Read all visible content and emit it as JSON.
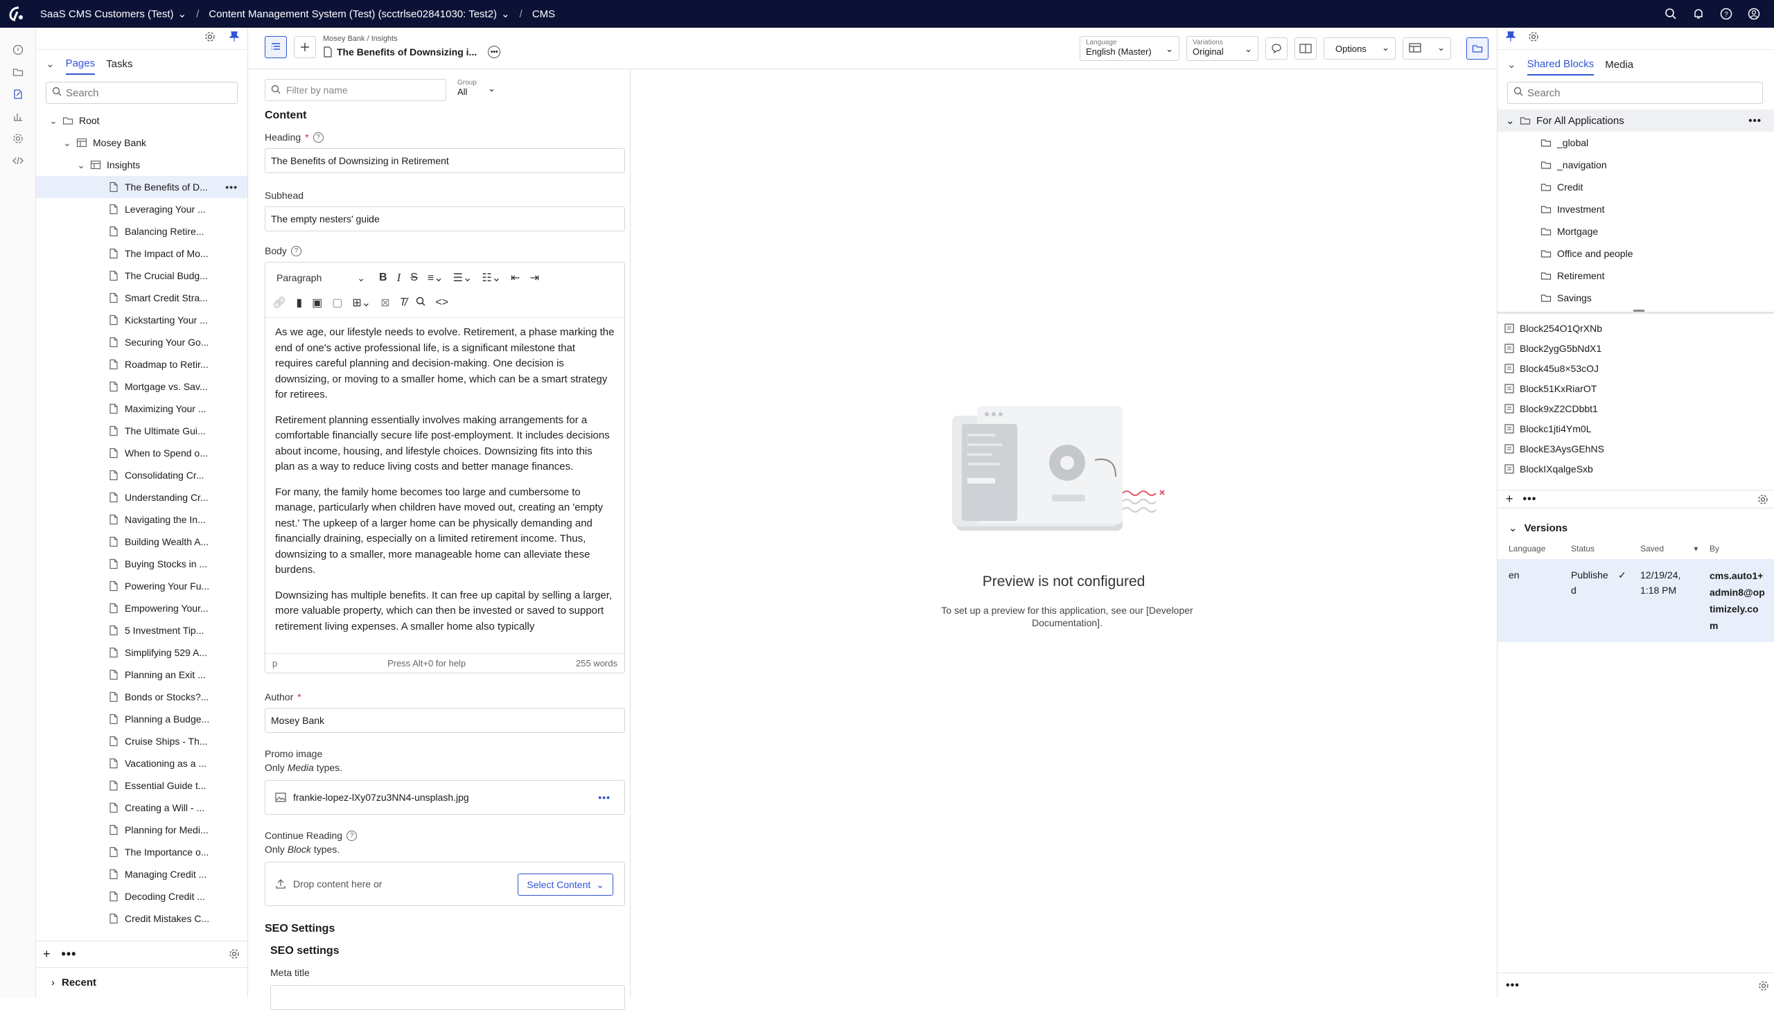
{
  "topbar": {
    "crumbs": [
      "SaaS CMS Customers (Test)",
      "Content Management System (Test) (scctrlse02841030: Test2)",
      "CMS"
    ]
  },
  "tree": {
    "tabs": [
      "Pages",
      "Tasks"
    ],
    "search_placeholder": "Search",
    "root": "Root",
    "site": "Mosey Bank",
    "folder": "Insights",
    "pages": [
      "The Benefits of D...",
      "Leveraging Your ...",
      "Balancing Retire...",
      "The Impact of Mo...",
      "The Crucial Budg...",
      "Smart Credit Stra...",
      "Kickstarting Your ...",
      "Securing Your Go...",
      "Roadmap to Retir...",
      "Mortgage vs. Sav...",
      "Maximizing Your ...",
      "The Ultimate Gui...",
      "When to Spend o...",
      "Consolidating Cr...",
      "Understanding Cr...",
      "Navigating the In...",
      "Building Wealth A...",
      "Buying Stocks in ...",
      "Powering Your Fu...",
      "Empowering Your...",
      "5 Investment Tip...",
      "Simplifying 529 A...",
      "Planning an Exit ...",
      "Bonds or Stocks?...",
      "Planning a Budge...",
      "Cruise Ships - Th...",
      "Vacationing as a ...",
      "Essential Guide t...",
      "Creating a Will - ...",
      "Planning for Medi...",
      "The Importance o...",
      "Managing Credit ...",
      "Decoding Credit ...",
      "Credit Mistakes C..."
    ],
    "recent": "Recent"
  },
  "editor": {
    "breadcrumb": "Mosey Bank  /  Insights",
    "title": "The Benefits of Downsizing i...",
    "language_label": "Language",
    "language_value": "English (Master)",
    "variations_label": "Variations",
    "variations_value": "Original",
    "options": "Options",
    "filter_placeholder": "Filter by name",
    "group_label": "Group",
    "group_value": "All",
    "section": "Content",
    "heading_label": "Heading",
    "heading_value": "The Benefits of Downsizing in Retirement",
    "subhead_label": "Subhead",
    "subhead_value": "The empty nesters' guide",
    "body_label": "Body",
    "paragraph_select": "Paragraph",
    "body_paragraphs": [
      "As we age, our lifestyle needs to evolve. Retirement, a phase marking the end of one's active professional life, is a significant milestone that requires careful planning and decision-making. One decision is downsizing, or moving to a smaller home, which can be a smart strategy for retirees.",
      "Retirement planning essentially involves making arrangements for a comfortable financially secure life post-employment. It includes decisions about income, housing, and lifestyle choices. Downsizing fits into this plan as a way to reduce living costs and better manage finances.",
      "For many, the family home becomes too large and cumbersome to manage, particularly when children have moved out, creating an 'empty nest.' The upkeep of a larger home can be physically demanding and financially draining, especially on a limited retirement income. Thus, downsizing to a smaller, more manageable home can alleviate these burdens.",
      "Downsizing has multiple benefits. It can free up capital by selling a larger, more valuable property, which can then be invested or saved to support retirement living expenses. A smaller home also typically"
    ],
    "rte_path": "p",
    "rte_help": "Press Alt+0 for help",
    "rte_words": "255 words",
    "author_label": "Author",
    "author_value": "Mosey Bank",
    "promo_label": "Promo image",
    "promo_only": "Only",
    "promo_type": "Media",
    "promo_suffix": "types.",
    "promo_file": "frankie-lopez-lXy07zu3NN4-unsplash.jpg",
    "continue_label": "Continue Reading",
    "continue_only": "Only",
    "continue_type": "Block",
    "continue_suffix": "types.",
    "drop_text": "Drop content here or",
    "select_content": "Select Content",
    "seo_section": "SEO Settings",
    "seo_sub": "SEO settings",
    "meta_title": "Meta title"
  },
  "preview": {
    "title": "Preview is not configured",
    "text": "To set up a preview for this application, see our [Developer Documentation]."
  },
  "right": {
    "tabs": [
      "Shared Blocks",
      "Media"
    ],
    "search_placeholder": "Search",
    "root_folder": "For All Applications",
    "folders": [
      "_global",
      "_navigation",
      "Credit",
      "Investment",
      "Mortgage",
      "Office and people",
      "Retirement",
      "Savings"
    ],
    "blocks": [
      "Block254O1QrXNb",
      "Block2ygG5bNdX1",
      "Block45u8×53cOJ",
      "Block51KxRiarOT",
      "Block9xZ2CDbbt1",
      "Blockc1jti4Ym0L",
      "BlockE3AysGEhNS",
      "BlockIXqalgeSxb"
    ],
    "versions_title": "Versions",
    "v_headers": [
      "Language",
      "Status",
      "Saved",
      "By"
    ],
    "v_lang": "en",
    "v_status": "Published",
    "v_saved": "12/19/24, 1:18 PM",
    "v_by": "cms.auto1+admin8@optimizely.com"
  }
}
